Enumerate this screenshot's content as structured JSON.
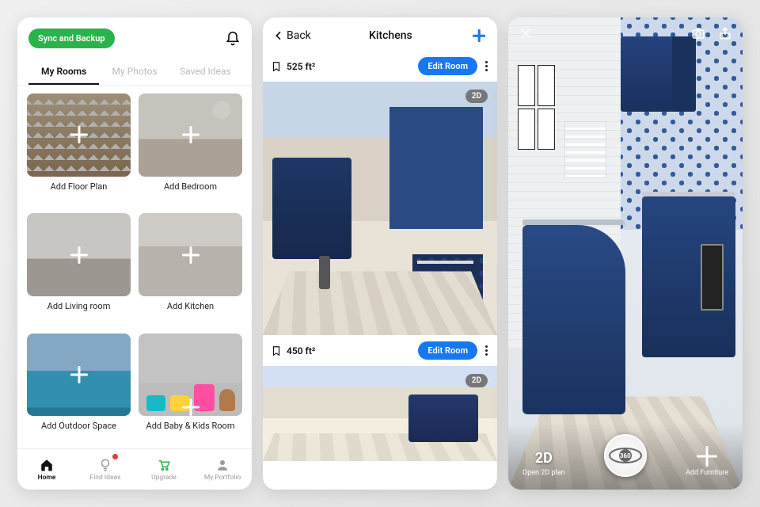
{
  "phone1": {
    "sync_label": "Sync and Backup",
    "tabs": [
      "My Rooms",
      "My Photos",
      "Saved Ideas"
    ],
    "active_tab": 0,
    "cards": [
      {
        "label": "Add Floor Plan",
        "thumb": "t-floor"
      },
      {
        "label": "Add Bedroom",
        "thumb": "t-bed"
      },
      {
        "label": "Add Living room",
        "thumb": "t-living"
      },
      {
        "label": "Add Kitchen",
        "thumb": "t-kitchen"
      },
      {
        "label": "Add Outdoor Space",
        "thumb": "t-outdoor"
      },
      {
        "label": "Add Baby & Kids Room",
        "thumb": "t-kids"
      }
    ],
    "bottom": [
      {
        "label": "Home",
        "icon": "home"
      },
      {
        "label": "Find Ideas",
        "icon": "bulb",
        "badge": true
      },
      {
        "label": "Upgrade",
        "icon": "cart"
      },
      {
        "label": "My Portfolio",
        "icon": "person"
      }
    ],
    "active_bottom": 0
  },
  "phone2": {
    "back_label": "Back",
    "title": "Kitchens",
    "rooms": [
      {
        "area": "525 ft²",
        "edit": "Edit Room",
        "view_badge": "2D"
      },
      {
        "area": "450 ft²",
        "edit": "Edit Room",
        "view_badge": "2D"
      }
    ]
  },
  "phone3": {
    "mode_label": "2D",
    "mode_sub": "Open 2D plan",
    "orbit_label": "360",
    "add_label": "Add Furniture"
  }
}
